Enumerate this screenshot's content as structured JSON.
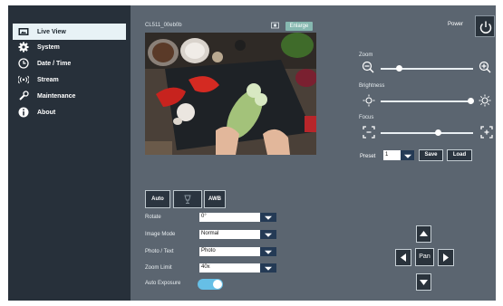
{
  "sidebar": {
    "items": [
      {
        "label": "Live View",
        "icon": "live-view-icon",
        "active": true
      },
      {
        "label": "System",
        "icon": "gear-icon"
      },
      {
        "label": "Date / Time",
        "icon": "clock-icon"
      },
      {
        "label": "Stream",
        "icon": "stream-icon"
      },
      {
        "label": "Maintenance",
        "icon": "wrench-icon"
      },
      {
        "label": "About",
        "icon": "info-icon"
      }
    ]
  },
  "video": {
    "camera_name": "CL511_00eb0b",
    "enlarge_label": "Enlarge"
  },
  "power": {
    "label": "Power"
  },
  "controls": {
    "zoom": {
      "label": "Zoom",
      "level": 0.2
    },
    "brightness": {
      "label": "Brightness",
      "level": 0.98
    },
    "focus": {
      "label": "Focus",
      "level": 0.62
    }
  },
  "preset": {
    "label": "Preset",
    "value": "1",
    "save_label": "Save",
    "load_label": "Load"
  },
  "modes": {
    "auto_label": "Auto",
    "awb_label": "AWB"
  },
  "settings": {
    "rotate": {
      "label": "Rotate",
      "value": "0°"
    },
    "image_mode": {
      "label": "Image Mode",
      "value": "Normal"
    },
    "photo_text": {
      "label": "Photo / Text",
      "value": "Photo"
    },
    "zoom_limit": {
      "label": "Zoom Limit",
      "value": "40x"
    },
    "auto_exposure": {
      "label": "Auto Exposure",
      "on": true
    }
  },
  "pan": {
    "label": "Pan"
  },
  "colors": {
    "sidebar_bg": "#27303a",
    "panel_bg": "#5b6570",
    "active_item": "#e8f2f6",
    "accent": "#66bfe6",
    "dropdown_arrow": "#243a55",
    "enlarge": "#86b8b0"
  }
}
